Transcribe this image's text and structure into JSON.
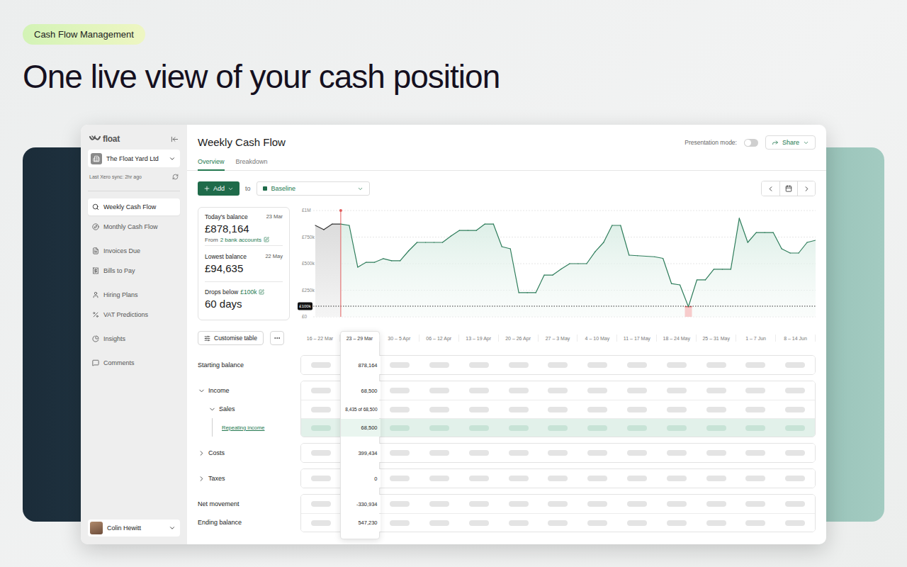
{
  "page": {
    "badge": "Cash Flow Management",
    "heading": "One live view of your cash position"
  },
  "sidebar": {
    "logo": "float",
    "company": "The Float Yard Ltd",
    "sync": "Last Xero sync: 2hr ago",
    "groups": [
      [
        {
          "label": "Weekly Cash Flow",
          "selected": true
        },
        {
          "label": "Monthly Cash Flow",
          "selected": false
        }
      ],
      [
        {
          "label": "Invoices Due",
          "selected": false
        },
        {
          "label": "Bills to Pay",
          "selected": false
        }
      ],
      [
        {
          "label": "Hiring Plans",
          "selected": false
        },
        {
          "label": "VAT Predictions",
          "selected": false
        }
      ],
      [
        {
          "label": "Insights",
          "selected": false
        }
      ],
      [
        {
          "label": "Comments",
          "selected": false
        }
      ]
    ],
    "user": "Colin Hewitt"
  },
  "header": {
    "title": "Weekly Cash Flow",
    "tabs": [
      {
        "label": "Overview",
        "selected": true
      },
      {
        "label": "Breakdown",
        "selected": false
      }
    ],
    "presentation_label": "Presentation mode:",
    "presentation_on": false,
    "share": "Share"
  },
  "toolbar": {
    "add": "Add",
    "to": "to",
    "scenario": "Baseline"
  },
  "summary": [
    {
      "label": "Today's balance",
      "link": "",
      "date": "23 Mar",
      "value": "£878,164",
      "note": "From",
      "note_link": "2 bank accounts"
    },
    {
      "label": "Lowest balance",
      "link": "",
      "date": "22 May",
      "value": "£94,635",
      "note": "",
      "note_link": ""
    },
    {
      "label": "Drops below",
      "link": "£100k",
      "date": "",
      "value": "60 days",
      "note": "",
      "note_link": ""
    }
  ],
  "chart": {
    "ticks": [
      {
        "label": "£1M",
        "value": 1000
      },
      {
        "label": "£750k",
        "value": 750
      },
      {
        "label": "£500k",
        "value": 500
      },
      {
        "label": "£250k",
        "value": 250
      },
      {
        "label": "£0",
        "value": 0
      }
    ],
    "threshold_label": "£100k",
    "threshold": 100,
    "today_index": 3,
    "values": [
      860,
      820,
      873,
      873,
      860,
      467,
      513,
      513,
      547,
      527,
      527,
      620,
      700,
      700,
      700,
      700,
      760,
      813,
      813,
      813,
      873,
      873,
      660,
      640,
      227,
      227,
      227,
      393,
      393,
      450,
      500,
      500,
      500,
      613,
      700,
      860,
      860,
      580,
      575,
      570,
      565,
      550,
      313,
      300,
      95,
      347,
      347,
      447,
      447,
      447,
      927,
      700,
      793,
      793,
      793,
      640,
      600,
      600,
      700,
      720
    ]
  },
  "table": {
    "customise": "Customise table",
    "columns": [
      {
        "label": "16 – 22 Mar",
        "selected": false
      },
      {
        "label": "23 – 29 Mar",
        "selected": true
      },
      {
        "label": "30 – 5 Apr",
        "selected": false
      },
      {
        "label": "06 – 12 Apr",
        "selected": false
      },
      {
        "label": "13 – 19 Apr",
        "selected": false
      },
      {
        "label": "20 – 26 Apr",
        "selected": false
      },
      {
        "label": "27 – 3 May",
        "selected": false
      },
      {
        "label": "4 – 10 May",
        "selected": false
      },
      {
        "label": "11 – 17 May",
        "selected": false
      },
      {
        "label": "18 – 24 May",
        "selected": false
      },
      {
        "label": "25 – 31 May",
        "selected": false
      },
      {
        "label": "1 – 7 Jun",
        "selected": false
      },
      {
        "label": "8 – 14 Jun",
        "selected": false
      }
    ],
    "groups": [
      {
        "rows": [
          {
            "label": "Starting balance",
            "kind": "plain",
            "expanded": false,
            "value": "878,164"
          }
        ]
      },
      {
        "rows": [
          {
            "label": "Income",
            "kind": "section",
            "expanded": true,
            "value": "68,500"
          },
          {
            "label": "Sales",
            "kind": "subsection",
            "expanded": true,
            "value": "8,435 of 68,500"
          },
          {
            "label": "Repeating income",
            "kind": "link",
            "expanded": false,
            "value": "68,500"
          }
        ]
      },
      {
        "rows": [
          {
            "label": "Costs",
            "kind": "section",
            "expanded": false,
            "value": "399,434"
          }
        ]
      },
      {
        "rows": [
          {
            "label": "Taxes",
            "kind": "section",
            "expanded": false,
            "value": "0"
          }
        ]
      },
      {
        "rows": [
          {
            "label": "Net movement",
            "kind": "plain",
            "expanded": false,
            "value": "-330,934"
          },
          {
            "label": "Ending balance",
            "kind": "plain",
            "expanded": false,
            "value": "547,230"
          }
        ]
      }
    ]
  }
}
